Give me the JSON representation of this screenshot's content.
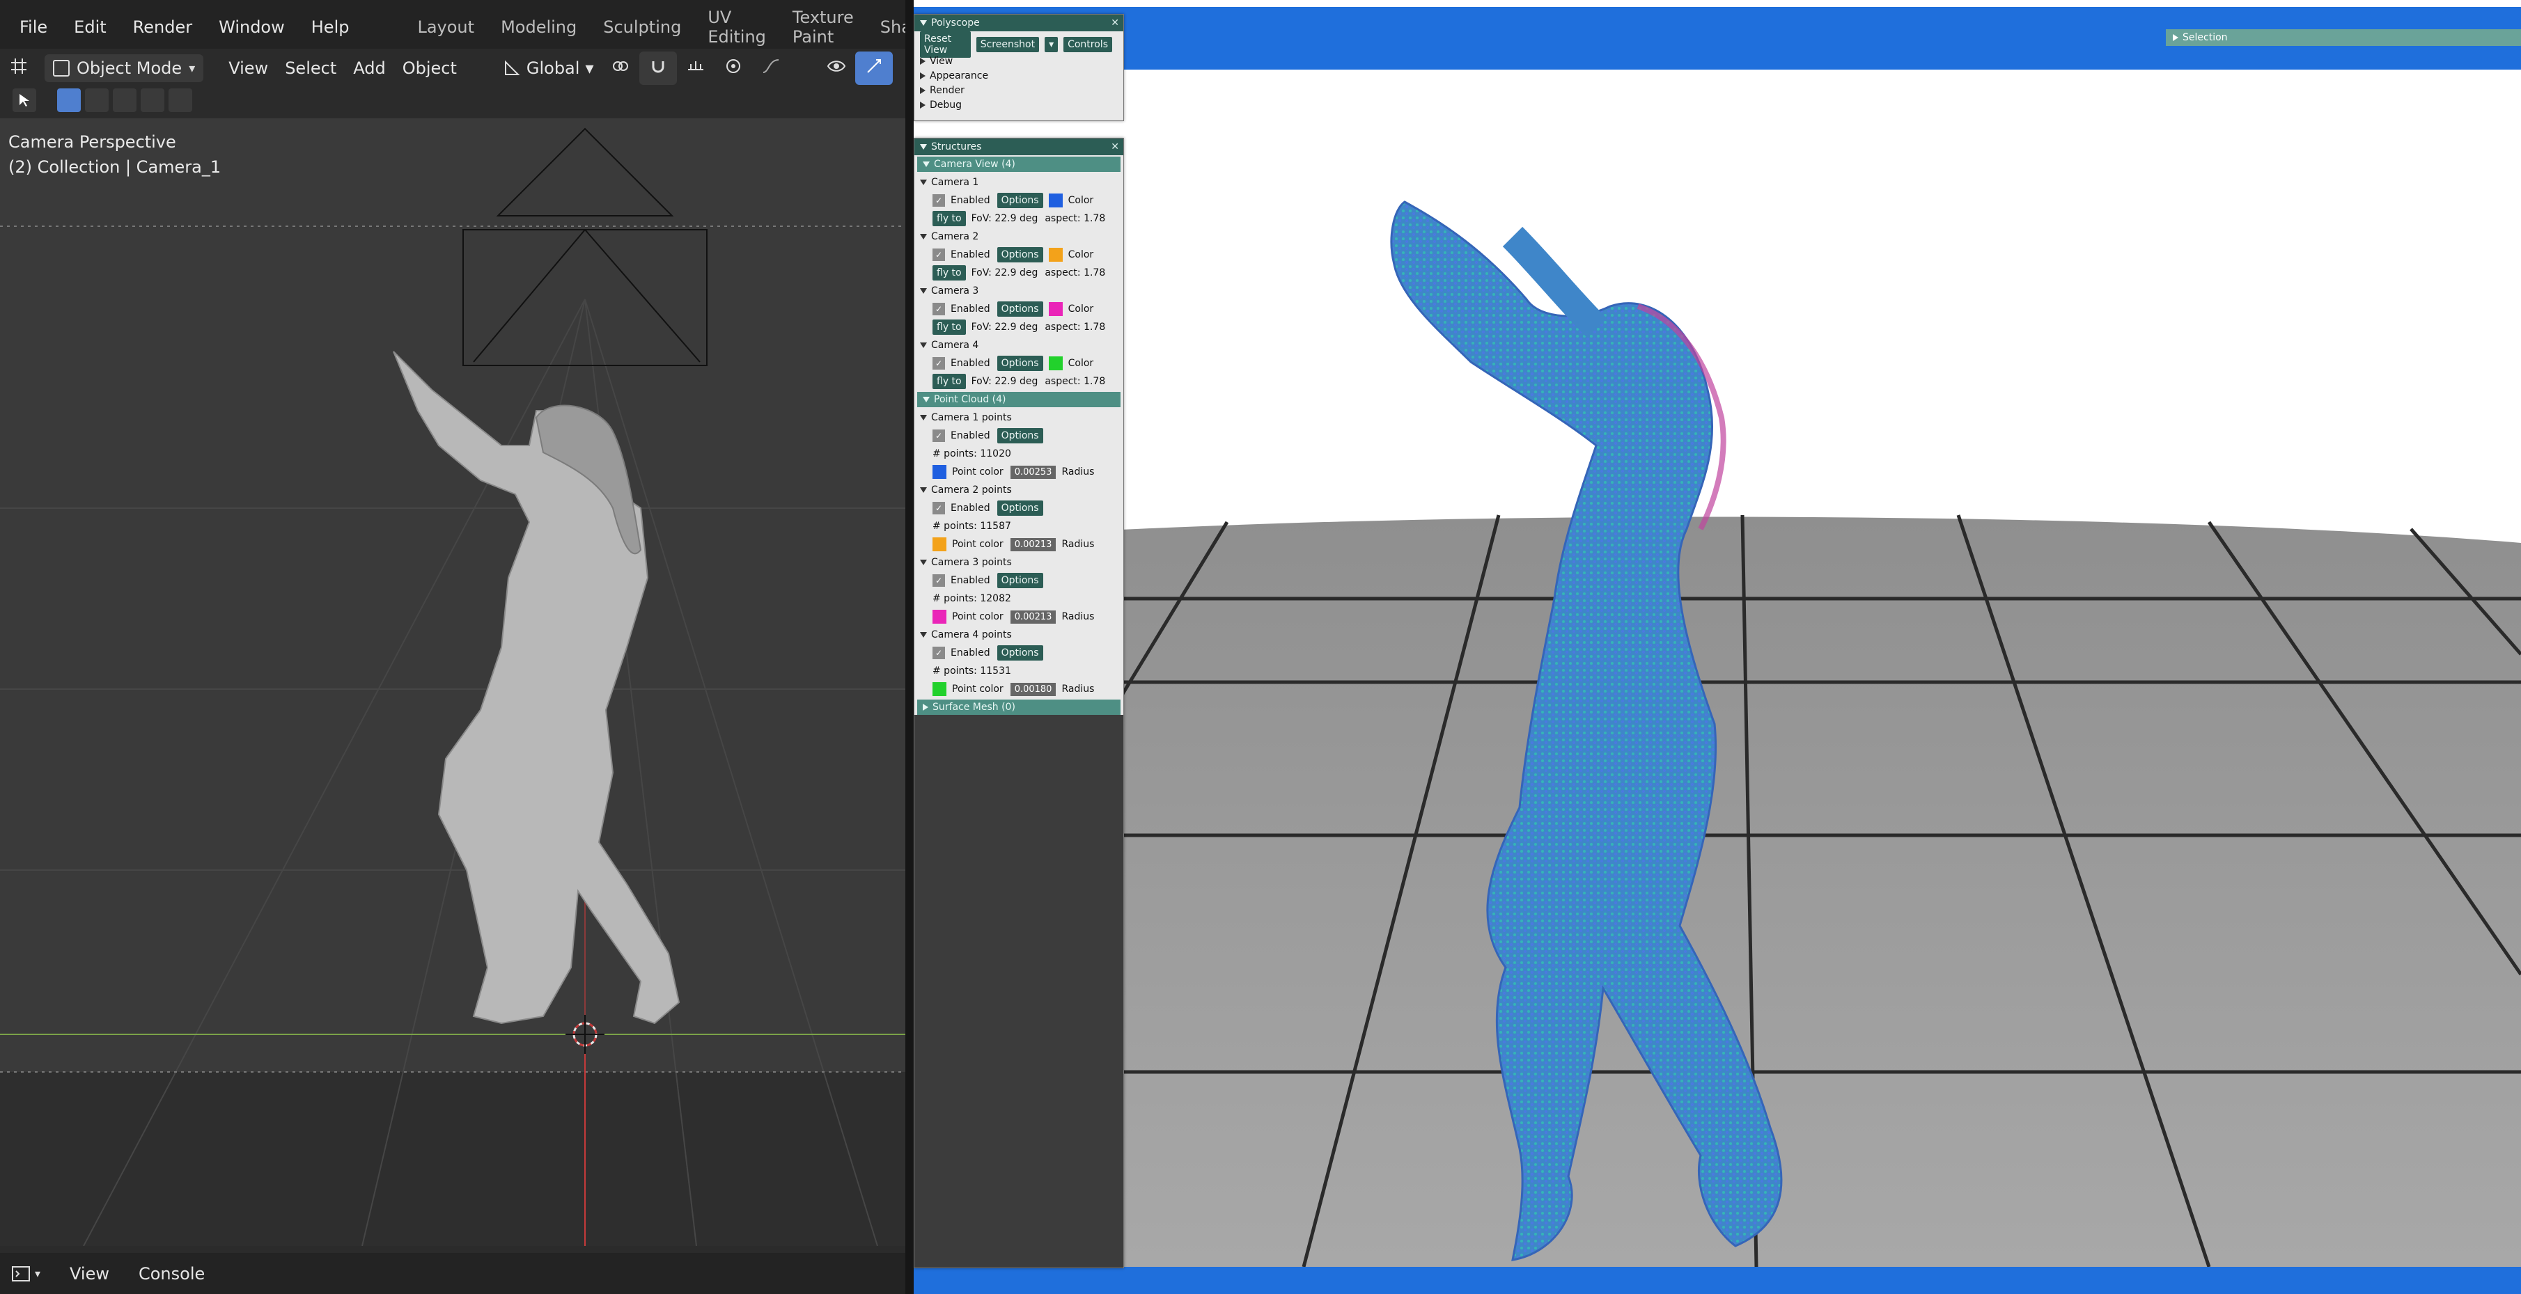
{
  "blender": {
    "menus": [
      "File",
      "Edit",
      "Render",
      "Window",
      "Help"
    ],
    "workspaces": [
      "Layout",
      "Modeling",
      "Sculpting",
      "UV Editing",
      "Texture Paint",
      "Shading"
    ],
    "toolbar": {
      "mode": "Object Mode",
      "view": "View",
      "select": "Select",
      "add": "Add",
      "object": "Object",
      "orientation": "Global"
    },
    "viewport": {
      "camera_label": "Camera Perspective",
      "collection_label": "(2) Collection | Camera_1"
    },
    "status": {
      "view": "View",
      "console": "Console"
    }
  },
  "polyscope": {
    "panel1": {
      "title": "Polyscope",
      "buttons": [
        "Reset View",
        "Screenshot",
        "Controls"
      ],
      "items": [
        "View",
        "Appearance",
        "Render",
        "Debug"
      ]
    },
    "panel2": {
      "title": "Structures",
      "camera_view_header": "Camera View (4)",
      "cameras": [
        {
          "name": "Camera 1",
          "enabled": "Enabled",
          "options": "Options",
          "color_label": "Color",
          "color": "#1f5fe0",
          "flyto": "fly to",
          "fov": "FoV: 22.9 deg",
          "aspect": "aspect: 1.78"
        },
        {
          "name": "Camera 2",
          "enabled": "Enabled",
          "options": "Options",
          "color_label": "Color",
          "color": "#f3a21a",
          "flyto": "fly to",
          "fov": "FoV: 22.9 deg",
          "aspect": "aspect: 1.78"
        },
        {
          "name": "Camera 3",
          "enabled": "Enabled",
          "options": "Options",
          "color_label": "Color",
          "color": "#ea25b8",
          "flyto": "fly to",
          "fov": "FoV: 22.9 deg",
          "aspect": "aspect: 1.78"
        },
        {
          "name": "Camera 4",
          "enabled": "Enabled",
          "options": "Options",
          "color_label": "Color",
          "color": "#22d12c",
          "flyto": "fly to",
          "fov": "FoV: 22.9 deg",
          "aspect": "aspect: 1.78"
        }
      ],
      "point_cloud_header": "Point Cloud (4)",
      "points": [
        {
          "name": "Camera 1 points",
          "enabled": "Enabled",
          "options": "Options",
          "count": "# points: 11020",
          "color": "#1f5fe0",
          "point_color": "Point color",
          "radius_val": "0.00253",
          "radius": "Radius"
        },
        {
          "name": "Camera 2 points",
          "enabled": "Enabled",
          "options": "Options",
          "count": "# points: 11587",
          "color": "#f3a21a",
          "point_color": "Point color",
          "radius_val": "0.00213",
          "radius": "Radius"
        },
        {
          "name": "Camera 3 points",
          "enabled": "Enabled",
          "options": "Options",
          "count": "# points: 12082",
          "color": "#ea25b8",
          "point_color": "Point color",
          "radius_val": "0.00213",
          "radius": "Radius"
        },
        {
          "name": "Camera 4 points",
          "enabled": "Enabled",
          "options": "Options",
          "count": "# points: 11531",
          "color": "#22d12c",
          "point_color": "Point color",
          "radius_val": "0.00180",
          "radius": "Radius"
        }
      ],
      "surface_mesh_header": "Surface Mesh (0)"
    },
    "selection": "Selection"
  }
}
